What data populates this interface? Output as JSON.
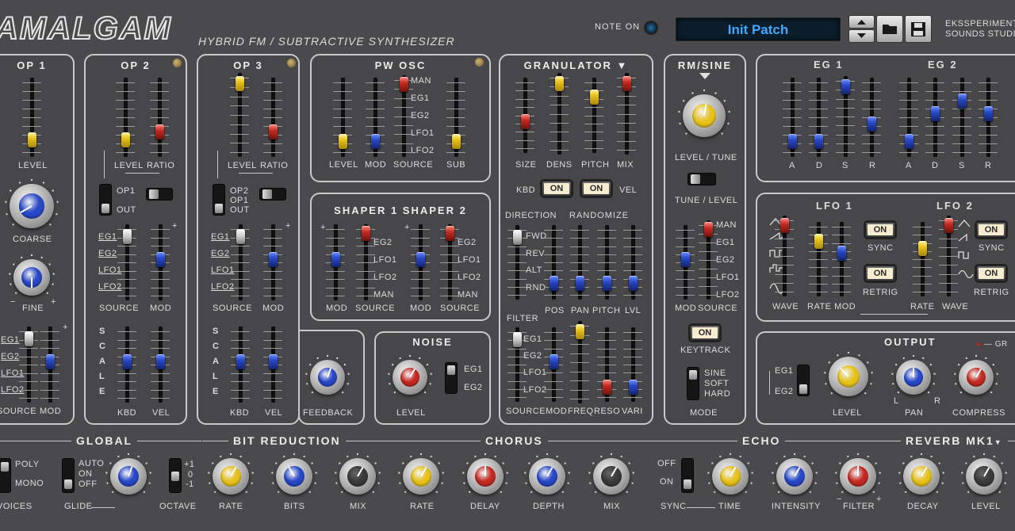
{
  "header": {
    "logo": "AMALGAM",
    "subtitle": "HYBRID FM / SUBTRACTIVE SYNTHESIZER",
    "note_on": "NOTE ON",
    "patch_name": "Init Patch",
    "brand_line1": "EKSSPERIMENTA",
    "brand_line2": "SOUNDS STUDIO"
  },
  "op1": {
    "title": "OP 1",
    "level": "LEVEL",
    "coarse": "COARSE",
    "fine": "FINE",
    "fine_minus": "−",
    "fine_plus": "+",
    "src": [
      "EG1",
      "EG2",
      "LFO1",
      "LFO2"
    ],
    "source": "SOURCE",
    "mod": "MOD",
    "plus": "+"
  },
  "op2": {
    "title": "OP 2",
    "level": "LEVEL",
    "ratio": "RATIO",
    "sw_top": "OP1",
    "sw_bot": "OUT",
    "src": [
      "EG1",
      "EG2",
      "LFO1",
      "LFO2"
    ],
    "source": "SOURCE",
    "mod": "MOD",
    "plus": "+",
    "scale": [
      "S",
      "C",
      "A",
      "L",
      "E"
    ],
    "kbd": "KBD",
    "vel": "VEL"
  },
  "op3": {
    "title": "OP 3",
    "level": "LEVEL",
    "ratio": "RATIO",
    "sw": [
      "OP2",
      "OP1",
      "OUT"
    ],
    "src": [
      "EG1",
      "EG2",
      "LFO1",
      "LFO2"
    ],
    "source": "SOURCE",
    "mod": "MOD",
    "plus": "+",
    "scale": [
      "S",
      "C",
      "A",
      "L",
      "E"
    ],
    "kbd": "KBD",
    "vel": "VEL",
    "feedback": "FEEDBACK"
  },
  "pwosc": {
    "title": "PW OSC",
    "src": [
      "MAN",
      "EG1",
      "EG2",
      "LFO1",
      "LFO2"
    ],
    "level": "LEVEL",
    "mod": "MOD",
    "source": "SOURCE",
    "sub": "SUB"
  },
  "shaper": {
    "title": "SHAPER 1 SHAPER 2",
    "src": [
      "EG2",
      "LFO1",
      "LFO2",
      "MAN"
    ],
    "mod1": "MOD",
    "source1": "SOURCE",
    "mod2": "MOD",
    "source2": "SOURCE",
    "plus": "+"
  },
  "noise": {
    "title": "NOISE",
    "level": "LEVEL",
    "eg1": "EG1",
    "eg2": "EG2"
  },
  "granulator": {
    "title": "GRANULATOR",
    "size": "SIZE",
    "dens": "DENS",
    "pitch": "PITCH",
    "mix": "MIX",
    "kbd": "KBD",
    "vel": "VEL",
    "on": "ON",
    "direction": "DIRECTION",
    "randomize": "RANDOMIZE",
    "dirs": [
      "FWD",
      "REV",
      "ALT",
      "RND"
    ],
    "pos": "POS",
    "pan": "PAN",
    "pitch2": "PITCH",
    "lvl": "LVL",
    "filter": "FILTER",
    "fsrc": [
      "EG1",
      "EG2",
      "LFO1",
      "LFO2"
    ],
    "source": "SOURCE",
    "mod": "MOD",
    "freq": "FREQ",
    "reso": "RESO",
    "vari": "VARI"
  },
  "rmsine": {
    "title": "RM/SINE",
    "level_tune": "LEVEL / TUNE",
    "tune_level": "TUNE / LEVEL",
    "src": [
      "MAN",
      "EG1",
      "EG2",
      "LFO1",
      "LFO2"
    ],
    "mod": "MOD",
    "source": "SOURCE",
    "on": "ON",
    "keytrack": "KEYTRACK",
    "modes": [
      "SINE",
      "SOFT",
      "HARD"
    ],
    "mode": "MODE"
  },
  "eg": {
    "eg1": "EG 1",
    "eg2": "EG 2",
    "labels": [
      "A",
      "D",
      "S",
      "R"
    ]
  },
  "lfo": {
    "lfo1": "LFO 1",
    "lfo2": "LFO 2",
    "wave": "WAVE",
    "rate_mod": "RATE MOD",
    "rate": "RATE",
    "sync": "SYNC",
    "retrig": "RETRIG",
    "on": "ON"
  },
  "output": {
    "title": "OUTPUT",
    "eg1": "EG1",
    "eg2": "EG2",
    "level": "LEVEL",
    "pan": "PAN",
    "l": "L",
    "r": "R",
    "compress": "COMPRESS",
    "gr": "GR"
  },
  "global": {
    "title": "GLOBAL",
    "poly": "POLY",
    "mono": "MONO",
    "voices": "VOICES",
    "auto": "AUTO",
    "on": "ON",
    "off": "OFF",
    "glide": "GLIDE",
    "oct": [
      "+1",
      "0",
      "-1"
    ],
    "octave": "OCTAVE"
  },
  "bit": {
    "title": "BIT REDUCTION",
    "rate": "RATE",
    "bits": "BITS",
    "mix": "MIX"
  },
  "chorus": {
    "title": "CHORUS",
    "rate": "RATE",
    "delay": "DELAY",
    "depth": "DEPTH",
    "mix": "MIX"
  },
  "echo": {
    "title": "ECHO",
    "off": "OFF",
    "on": "ON",
    "sync": "SYNC",
    "time": "TIME",
    "intensity": "INTENSITY",
    "filter": "FILTER",
    "minus": "−",
    "plus": "+"
  },
  "reverb": {
    "title": "REVERB MK1",
    "decay": "DECAY",
    "level": "LEVEL"
  },
  "colors": {
    "yellow": "#e8c21a",
    "blue": "#2848c8",
    "red": "#c42a22",
    "dark": "#3a3a3a",
    "white": "#dcdcdc",
    "lcd_text": "#3fa8ff"
  }
}
